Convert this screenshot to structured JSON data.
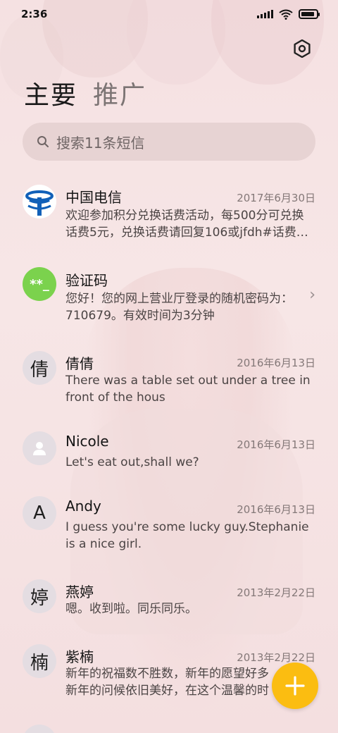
{
  "status_bar": {
    "time": "2:36",
    "battery_level": 0.9
  },
  "tabs": {
    "primary": "主要",
    "secondary": "推广"
  },
  "search": {
    "placeholder": "搜索11条短信"
  },
  "messages": [
    {
      "sender": "中国电信",
      "date": "2017年6月30日",
      "line1": "欢迎参加积分兑换话费活动，每500分可兑换",
      "line2": "话费5元，兑换话费请回复106或jfdh#话费…",
      "avatar_type": "telecom-logo"
    },
    {
      "sender": "验证码",
      "date": "",
      "line1": "您好！您的网上营业厅登录的随机密码为：",
      "line2": "710679。有效时间为3分钟",
      "avatar_text": "**_",
      "avatar_color": "#7bd24d"
    },
    {
      "sender": "倩倩",
      "date": "2016年6月13日",
      "line1": "There was a table set out under a tree in",
      "line2": "front of the hous",
      "avatar_text": "倩"
    },
    {
      "sender": "Nicole",
      "date": "2016年6月13日",
      "line1": "Let's eat out,shall we?",
      "line2": "",
      "avatar_type": "person-icon"
    },
    {
      "sender": "Andy",
      "date": "2016年6月13日",
      "line1": "I guess you're some lucky guy.Stephanie",
      "line2": "is a nice girl.",
      "avatar_text": "A"
    },
    {
      "sender": "燕婷",
      "date": "2013年2月22日",
      "line1": "嗯。收到啦。同乐同乐。",
      "line2": "",
      "avatar_text": "婷"
    },
    {
      "sender": "紫楠",
      "date": "2013年2月22日",
      "line1": "新年的祝福数不胜数，新年的愿望好多",
      "line2": "新年的问候依旧美好，在这个温馨的时",
      "avatar_text": "楠"
    }
  ],
  "fab": {
    "accent": "#fbbd11",
    "icon": "plus-icon"
  }
}
